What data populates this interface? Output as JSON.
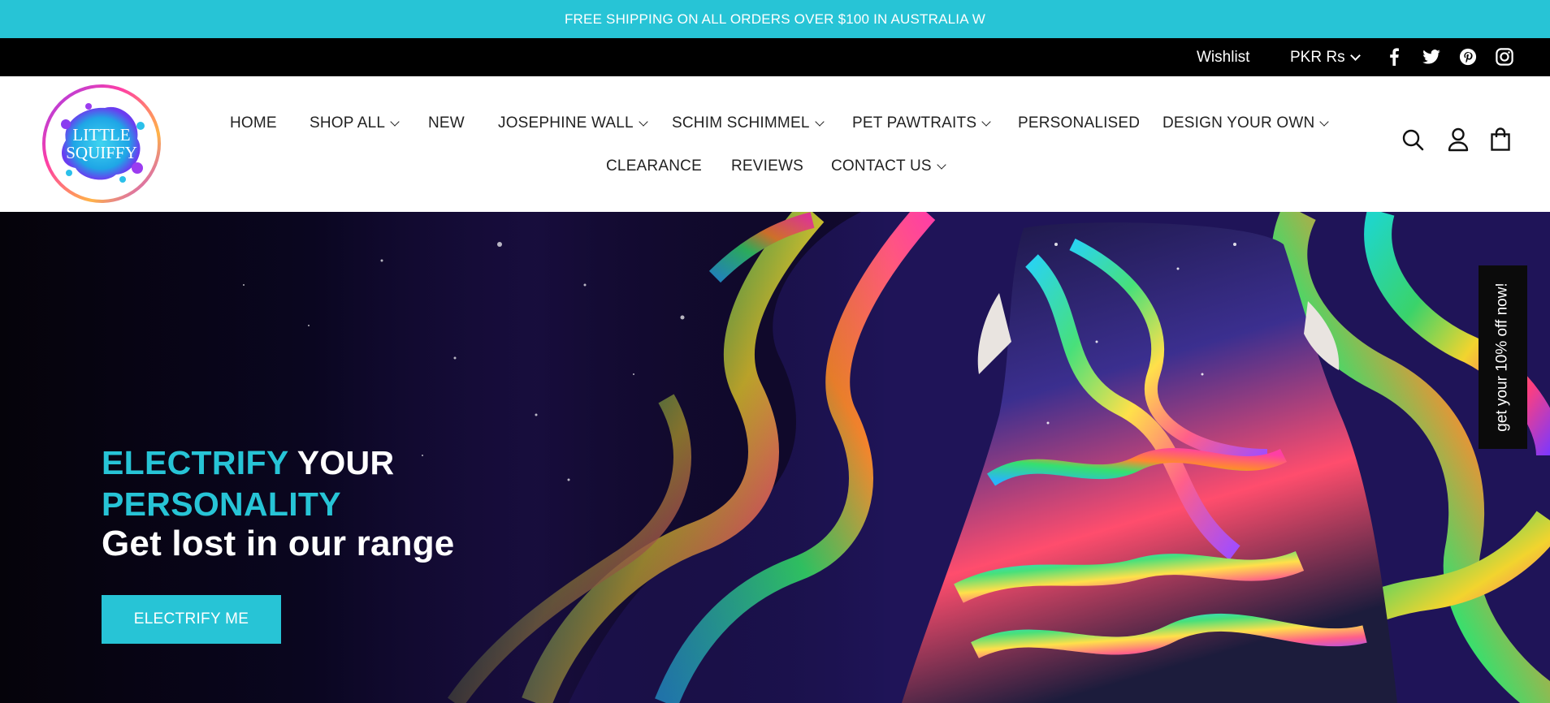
{
  "announcement": {
    "text": "FREE SHIPPING ON ALL ORDERS OVER $100 IN AUSTRALIA W"
  },
  "utility_bar": {
    "wishlist": "Wishlist",
    "currency": "PKR Rs",
    "social_icons": [
      "facebook-icon",
      "twitter-icon",
      "pinterest-icon",
      "instagram-icon"
    ]
  },
  "header": {
    "logo_text_line1": "LITTLE",
    "logo_text_line2": "SQUIFFY",
    "nav": {
      "home": "HOME",
      "shop_all": "SHOP ALL",
      "new": "NEW",
      "josephine_wall": "JOSEPHINE WALL",
      "schim_schimmel": "SCHIM SCHIMMEL",
      "pet_pawtraits": "PET PAWTRAITS",
      "personalised": "PERSONALISED",
      "design_your_own": "DESIGN YOUR OWN",
      "clearance": "CLEARANCE",
      "reviews": "REVIEWS",
      "contact_us": "CONTACT US"
    },
    "icons": [
      "search-icon",
      "account-icon",
      "cart-icon"
    ]
  },
  "hero": {
    "headline_word1": "ELECTRIFY",
    "headline_word2": "YOUR",
    "headline_word3": "PERSONALITY",
    "subheadline": "Get lost in our range",
    "cta_label": "ELECTRIFY ME"
  },
  "side_tab": {
    "text": "get your 10% off now!"
  },
  "colors": {
    "accent": "#27c4d6",
    "nav_text": "#222222",
    "header_bg": "#ffffff",
    "utility_bg": "#000000"
  }
}
